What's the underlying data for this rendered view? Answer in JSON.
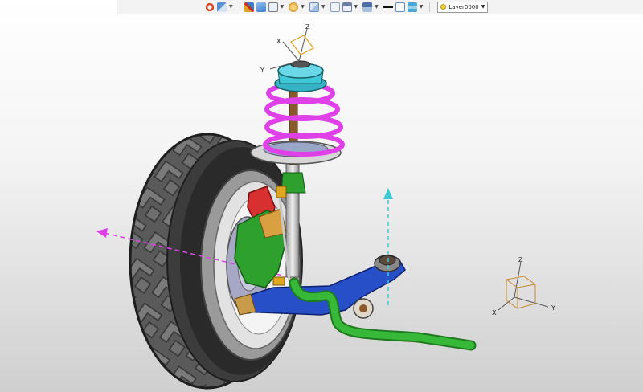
{
  "toolbar": {
    "buttons": [
      {
        "icon": "refresh-icon",
        "color": "#d04a2a"
      },
      {
        "icon": "select-tool-icon",
        "color": "#5a8fd6"
      },
      {
        "icon": "transform-icon",
        "color": "#e0a020"
      },
      {
        "icon": "shaded-cube-icon",
        "color": "#3c7ccf"
      },
      {
        "icon": "wireframe-cube-icon",
        "color": "#7a7a7a"
      },
      {
        "icon": "render-mode-icon",
        "color": "#d89a2a"
      },
      {
        "icon": "view-orient-icon",
        "color": "#6a8fbf"
      },
      {
        "icon": "section-view-icon",
        "color": "#8aa0c0"
      },
      {
        "icon": "save-view-icon",
        "color": "#6a7fa8"
      },
      {
        "icon": "display-filter-icon",
        "color": "#4a6fa8"
      },
      {
        "icon": "line-style-icon",
        "color": "#111111"
      },
      {
        "icon": "frame-icon",
        "color": "#5a8fd6"
      },
      {
        "icon": "layer-manager-icon",
        "color": "#4aa8d6"
      }
    ],
    "layer_select": {
      "value": "Layer0000"
    }
  },
  "viewport": {
    "top_triad": {
      "x": "X",
      "y": "Y",
      "z": "Z"
    },
    "corner_triad": {
      "x": "X",
      "y": "Y",
      "z": "Z"
    }
  },
  "colors": {
    "spring": "#e040e8",
    "strut_mount": "#40c8d8",
    "upright": "#2ea02e",
    "control_arm": "#2750c8",
    "stabilizer_bar": "#38b838",
    "tire": "#555555",
    "caliper": "#d83030"
  }
}
